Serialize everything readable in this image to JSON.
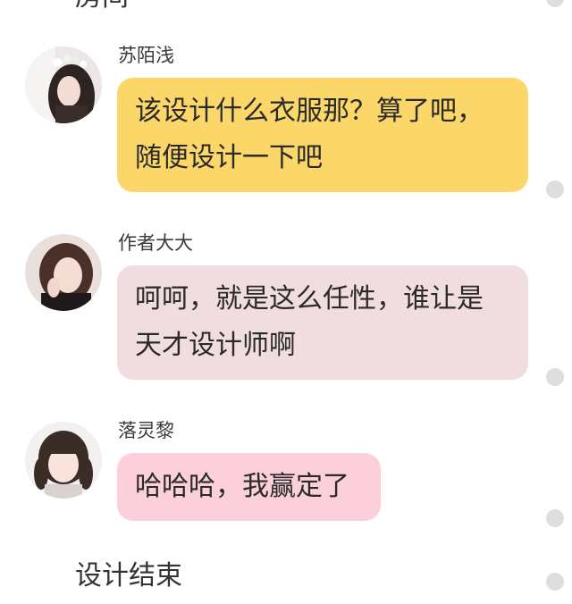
{
  "top_partial_text": "房间",
  "messages": [
    {
      "sender": "苏陌浅",
      "lines": [
        "该设计什么衣服那？算了吧，",
        "随便设计一下吧"
      ],
      "bubble_color": "#fbd669",
      "avatar": "avatar-girl-flower-crown"
    },
    {
      "sender": "作者大大",
      "lines": [
        "呵呵，就是这么任性，谁让是",
        "天才设计师啊"
      ],
      "bubble_color": "#f1dcdf",
      "avatar": "avatar-girl-hand-on-chin"
    },
    {
      "sender": "落灵黎",
      "lines": [
        "哈哈哈，我赢定了"
      ],
      "bubble_color": "#fbd0db",
      "avatar": "avatar-girl-twin-tails"
    }
  ],
  "footer_text": "设计结束",
  "scroll_dot_color": "#dedede"
}
